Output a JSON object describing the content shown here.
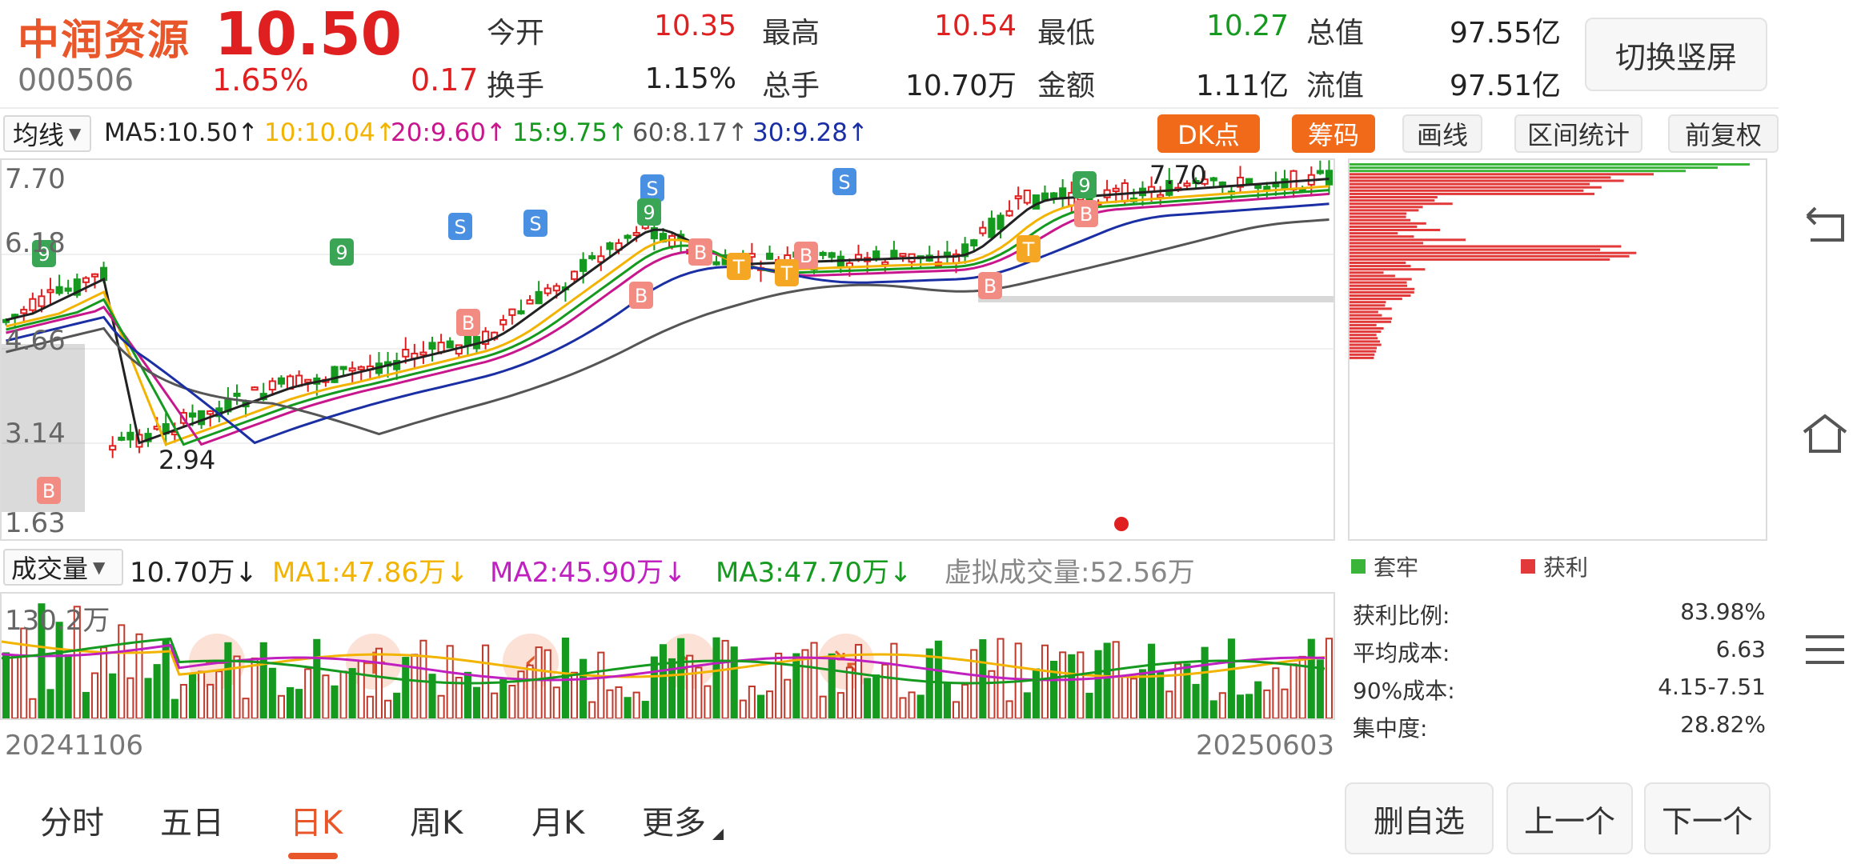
{
  "header": {
    "name": "中润资源",
    "price": "10.50",
    "code": "000506",
    "pct": "1.65%",
    "change": "0.17",
    "quotes": [
      {
        "label": "今开",
        "value": "10.35",
        "color": "red"
      },
      {
        "label": "最高",
        "value": "10.54",
        "color": "red"
      },
      {
        "label": "最低",
        "value": "10.27",
        "color": "green"
      },
      {
        "label": "总值",
        "value": "97.55亿",
        "color": "dark"
      },
      {
        "label": "换手",
        "value": "1.15%",
        "color": "dark"
      },
      {
        "label": "总手",
        "value": "10.70万",
        "color": "dark"
      },
      {
        "label": "金额",
        "value": "1.11亿",
        "color": "dark"
      },
      {
        "label": "流值",
        "value": "97.51亿",
        "color": "dark"
      }
    ],
    "switch_label": "切换竖屏"
  },
  "ma_bar": {
    "selector": "均线",
    "items": [
      {
        "text": "MA5:10.50↑",
        "color": "#222222"
      },
      {
        "text": "10:10.04↑",
        "color": "#f2b400"
      },
      {
        "text": "20:9.60↑",
        "color": "#c8168c"
      },
      {
        "text": "15:9.75↑",
        "color": "#159a1f"
      },
      {
        "text": "60:8.17↑",
        "color": "#555555"
      },
      {
        "text": "30:9.28↑",
        "color": "#1b2fa5"
      }
    ],
    "buttons": {
      "dk": "DK点",
      "chip": "筹码",
      "draw": "画线",
      "range": "区间统计",
      "adjust": "前复权"
    }
  },
  "kline": {
    "axis": [
      "7.70",
      "6.18",
      "4.66",
      "3.14",
      "1.63"
    ],
    "high_label": "7.70",
    "low_label": "2.94",
    "controls": {
      "minus": "−",
      "plus": "+",
      "left": "‹",
      "right": "›"
    }
  },
  "volume": {
    "selector": "成交量",
    "current": "10.70万↓",
    "ma1": "MA1:47.86万↓",
    "ma2": "MA2:45.90万↓",
    "ma3": "MA3:47.70万↓",
    "virtual": "虚拟成交量:52.56万",
    "max": "130.2万"
  },
  "dates": {
    "start": "20241106",
    "end": "20250603"
  },
  "chips": {
    "legend_loss": "套牢",
    "legend_profit": "获利",
    "loss_color": "#3ab53a",
    "profit_color": "#e23a3a",
    "stats": [
      {
        "label": "获利比例:",
        "value": "83.98%"
      },
      {
        "label": "平均成本:",
        "value": "6.63"
      },
      {
        "label": "90%成本:",
        "value": "4.15-7.51"
      },
      {
        "label": "集中度:",
        "value": "28.82%"
      }
    ]
  },
  "tabs": [
    "分时",
    "五日",
    "日K",
    "周K",
    "月K",
    "更多"
  ],
  "bottom_buttons": {
    "remove": "删自选",
    "prev": "上一个",
    "next": "下一个"
  },
  "colors": {
    "accent": "#e8562a",
    "up": "#e02020",
    "down": "#159a1f"
  }
}
